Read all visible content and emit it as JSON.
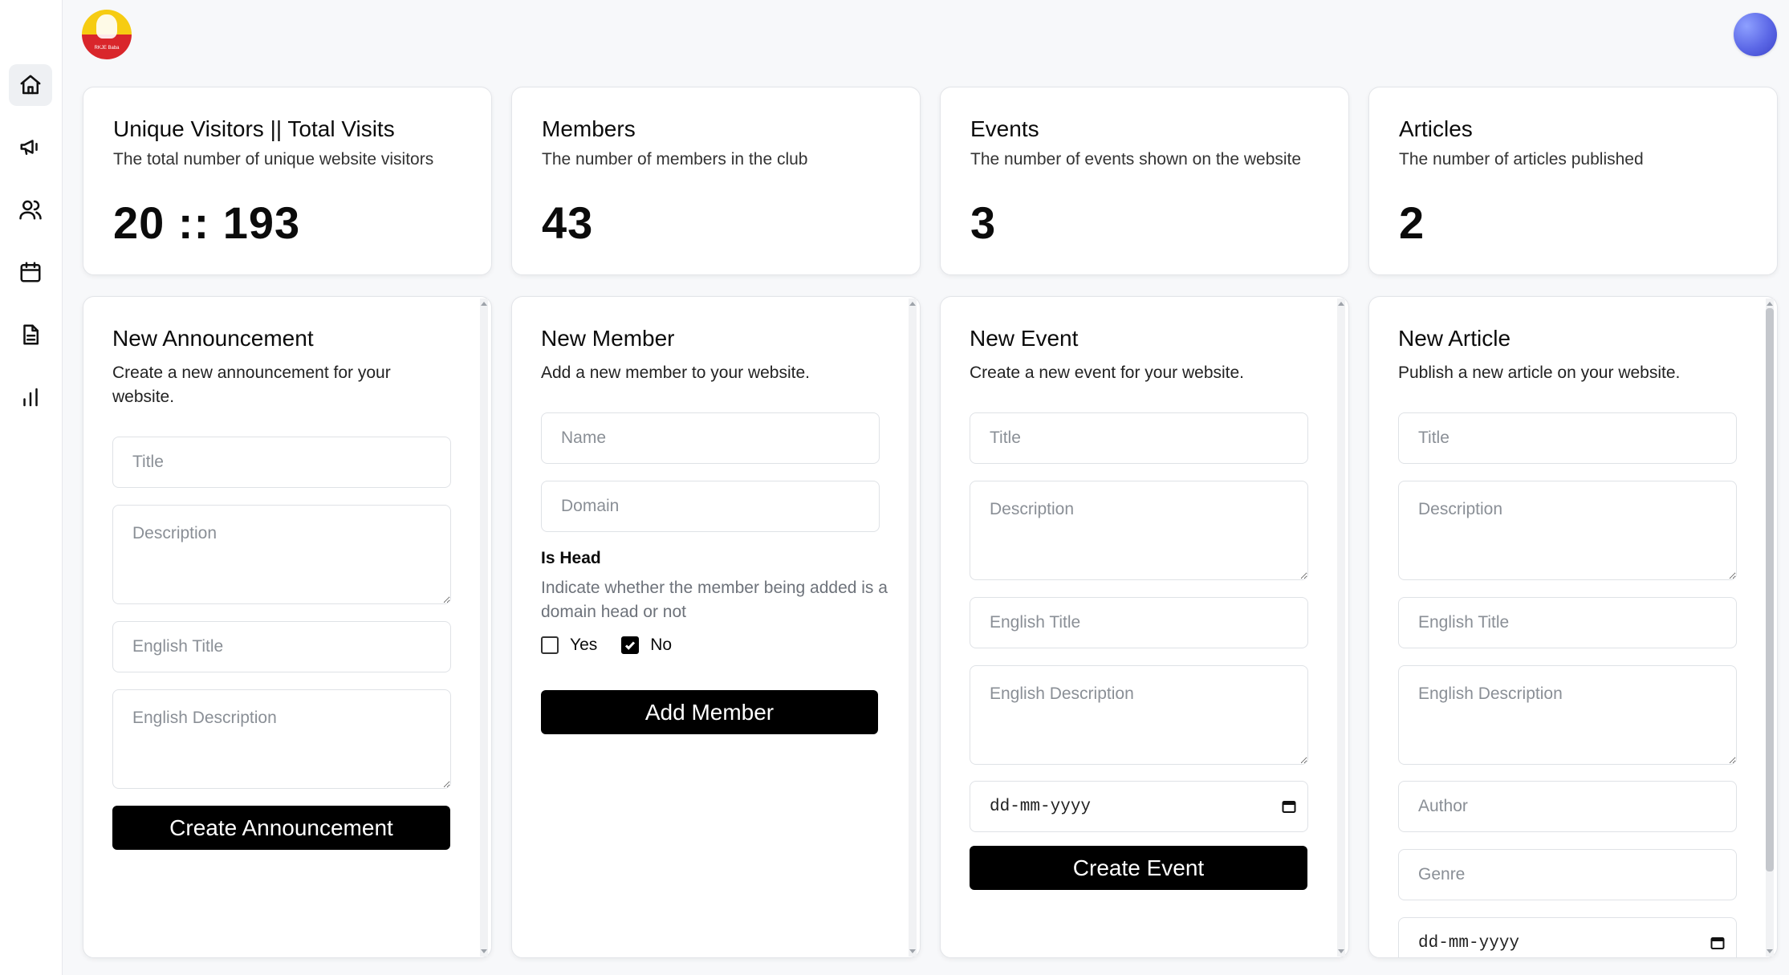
{
  "header": {
    "logo_text": "RKJE Baba"
  },
  "sidebar": {
    "items": [
      {
        "name": "home",
        "icon": "home-icon",
        "active": true
      },
      {
        "name": "announcements",
        "icon": "megaphone-icon",
        "active": false
      },
      {
        "name": "members",
        "icon": "users-icon",
        "active": false
      },
      {
        "name": "events",
        "icon": "calendar-icon",
        "active": false
      },
      {
        "name": "articles",
        "icon": "document-icon",
        "active": false
      },
      {
        "name": "analytics",
        "icon": "bar-chart-icon",
        "active": false
      }
    ]
  },
  "stats": [
    {
      "title": "Unique Visitors || Total Visits",
      "description": "The total number of unique website visitors",
      "value": "20 :: 193"
    },
    {
      "title": "Members",
      "description": "The number of members in the club",
      "value": "43"
    },
    {
      "title": "Events",
      "description": "The number of events shown on the website",
      "value": "3"
    },
    {
      "title": "Articles",
      "description": "The number of articles published",
      "value": "2"
    }
  ],
  "announcement_form": {
    "title": "New Announcement",
    "subtitle": "Create a new announcement for your website.",
    "title_placeholder": "Title",
    "description_placeholder": "Description",
    "english_title_placeholder": "English Title",
    "english_description_placeholder": "English Description",
    "submit_label": "Create Announcement"
  },
  "member_form": {
    "title": "New Member",
    "subtitle": "Add a new member to your website.",
    "name_placeholder": "Name",
    "domain_placeholder": "Domain",
    "is_head_label": "Is Head",
    "is_head_description": "Indicate whether the member being added is a domain head or not",
    "yes_label": "Yes",
    "no_label": "No",
    "yes_checked": false,
    "no_checked": true,
    "submit_label": "Add Member"
  },
  "event_form": {
    "title": "New Event",
    "subtitle": "Create a new event for your website.",
    "title_placeholder": "Title",
    "description_placeholder": "Description",
    "english_title_placeholder": "English Title",
    "english_description_placeholder": "English Description",
    "date_value": "dd-mm-yyyy",
    "submit_label": "Create Event"
  },
  "article_form": {
    "title": "New Article",
    "subtitle": "Publish a new article on your website.",
    "title_placeholder": "Title",
    "description_placeholder": "Description",
    "english_title_placeholder": "English Title",
    "english_description_placeholder": "English Description",
    "author_placeholder": "Author",
    "genre_placeholder": "Genre",
    "date_value": "dd-mm-yyyy"
  },
  "colors": {
    "background": "#f7f8fa",
    "card": "#ffffff",
    "button": "#000000",
    "logo_yellow": "#f6cc12",
    "logo_red": "#d9262b",
    "avatar": "#5b67e6"
  }
}
